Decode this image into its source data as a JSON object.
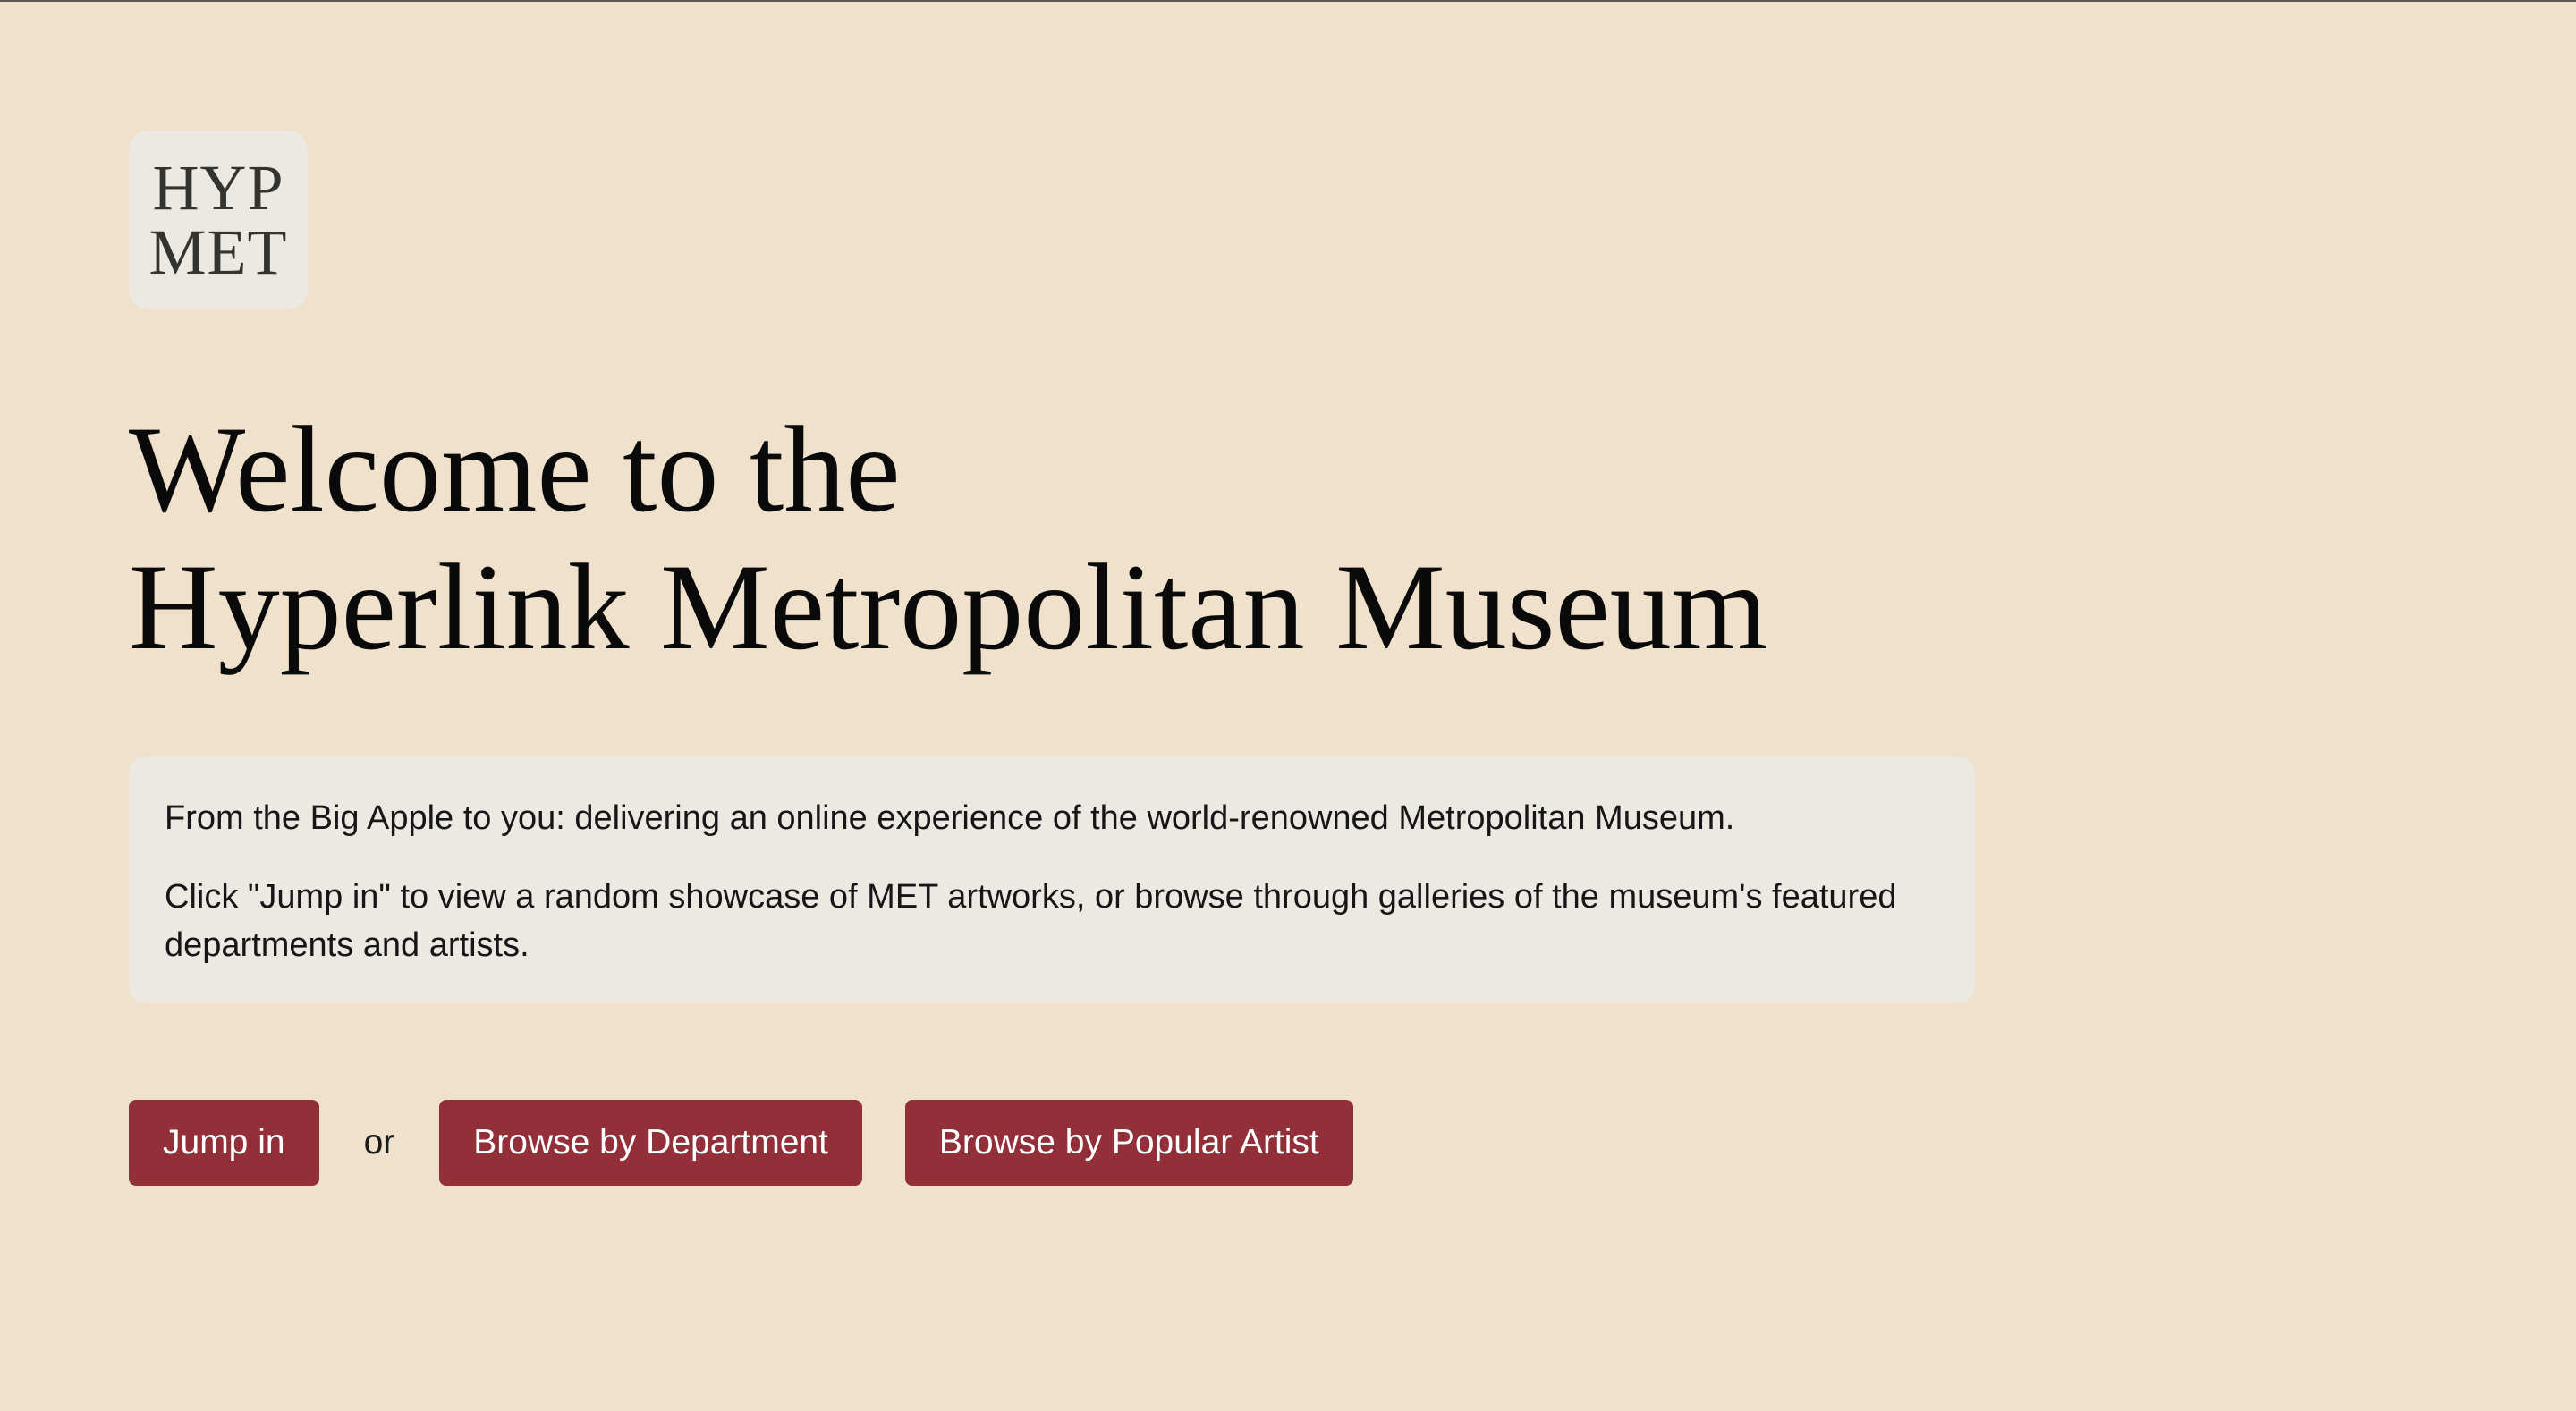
{
  "logo": {
    "line1": "HYP",
    "line2": "MET"
  },
  "hero": {
    "title_line1": "Welcome to the",
    "title_line2": "Hyperlink Metropolitan Museum"
  },
  "intro": {
    "paragraph1": "From the Big Apple to you: delivering an online experience of the world-renowned Metropolitan Museum.",
    "paragraph2": "Click \"Jump in\" to view a random showcase of MET artworks, or browse through galleries of the museum's featured departments and artists."
  },
  "actions": {
    "jump_in_label": "Jump in",
    "or_label": "or",
    "browse_department_label": "Browse by Department",
    "browse_artist_label": "Browse by Popular Artist"
  },
  "colors": {
    "background": "#efe1cb",
    "card": "#ece8e2",
    "button": "#922f38",
    "button_text": "#ffffff"
  }
}
